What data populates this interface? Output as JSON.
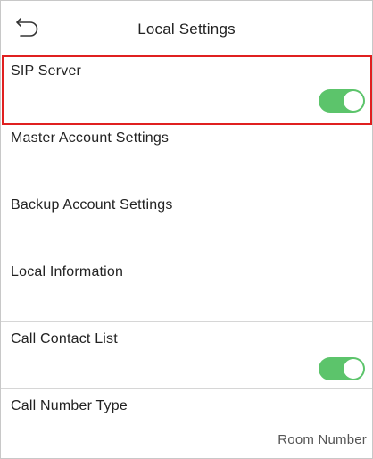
{
  "header": {
    "back_icon": "back-arrow-icon",
    "title": "Local Settings"
  },
  "items": [
    {
      "label": "SIP Server",
      "toggle": true,
      "toggle_on": true
    },
    {
      "label": "Master Account Settings"
    },
    {
      "label": "Backup Account Settings"
    },
    {
      "label": "Local Information"
    },
    {
      "label": "Call Contact List",
      "toggle": true,
      "toggle_on": true
    },
    {
      "label": "Call Number Type",
      "value": "Room Number"
    }
  ],
  "colors": {
    "toggle_on": "#5cc46b",
    "highlight_border": "#e02020",
    "divider": "#d6d6d6"
  }
}
